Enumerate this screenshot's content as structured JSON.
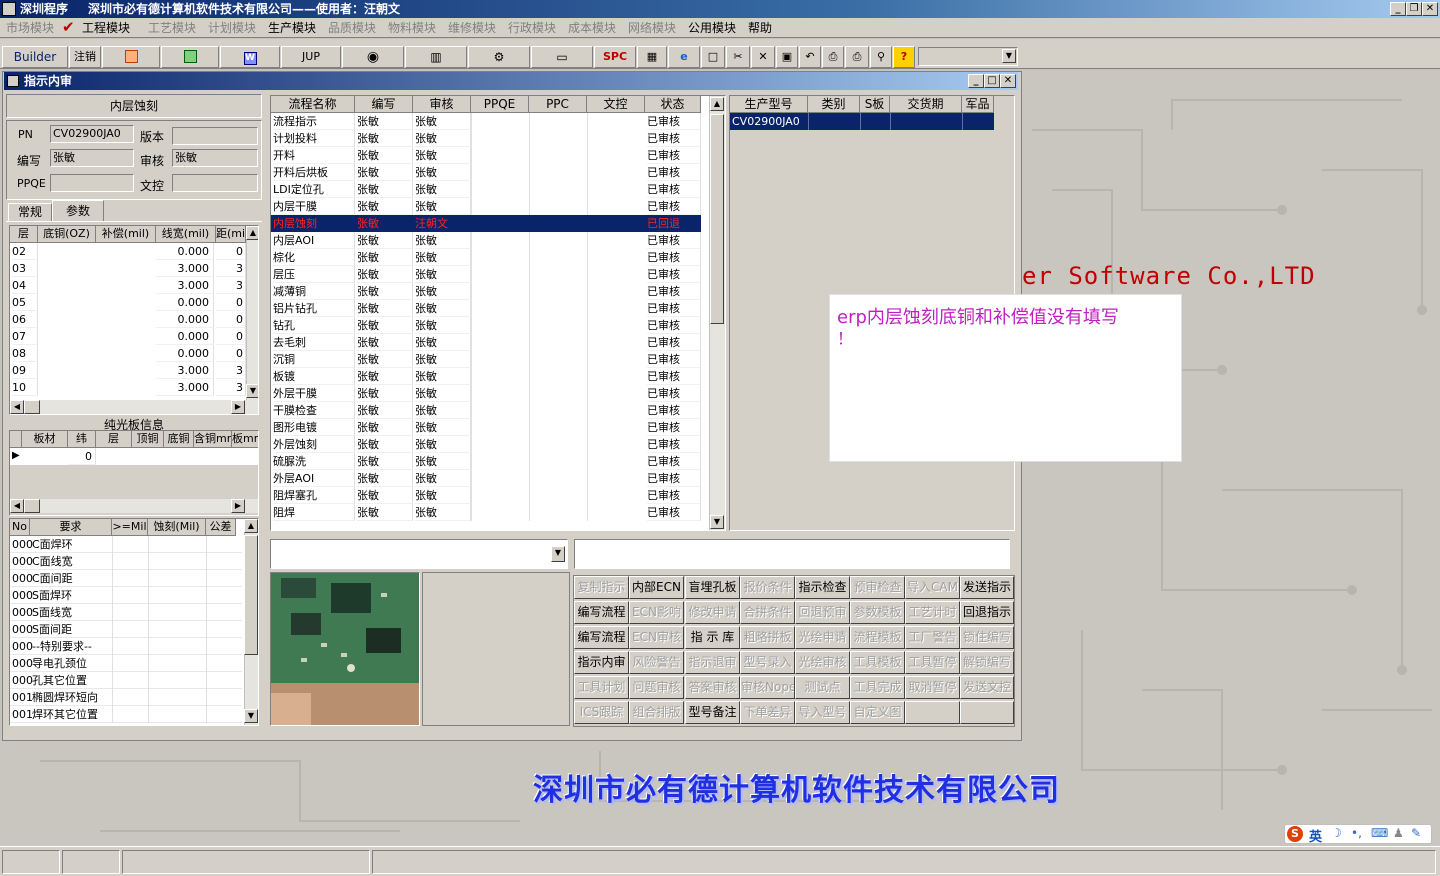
{
  "titlebar": {
    "app": "深圳程序",
    "company_user": "深圳市必有德计算机软件技术有限公司——使用者：汪朝文"
  },
  "menu": [
    {
      "label": "市场模块",
      "enabled": false
    },
    {
      "label": "工程模块",
      "enabled": true
    },
    {
      "label": "工艺模块",
      "enabled": false
    },
    {
      "label": "计划模块",
      "enabled": false
    },
    {
      "label": "生产模块",
      "enabled": true
    },
    {
      "label": "品质模块",
      "enabled": false
    },
    {
      "label": "物料模块",
      "enabled": false
    },
    {
      "label": "维修模块",
      "enabled": false
    },
    {
      "label": "行政模块",
      "enabled": false
    },
    {
      "label": "成本模块",
      "enabled": false
    },
    {
      "label": "网络模块",
      "enabled": false
    },
    {
      "label": "公用模块",
      "enabled": true
    },
    {
      "label": "帮助",
      "enabled": true
    }
  ],
  "toolbar": {
    "builder": "Builder",
    "zhuxiao": "注销",
    "jup": "JUP",
    "spc": "SPC"
  },
  "window": {
    "title": "指示内审"
  },
  "left": {
    "process_name": "内层蚀刻",
    "pn_label": "PN",
    "pn_value": "CV02900JA0",
    "version_label": "版本",
    "version_value": "",
    "author_label": "编写",
    "author_value": "张敏",
    "reviewer_label": "审核",
    "reviewer_value": "张敏",
    "ppqe_label": "PPQE",
    "ppqe_value": "",
    "wenkong_label": "文控",
    "wenkong_value": "",
    "tabs": [
      "常规",
      "参数"
    ],
    "layer_headers": [
      "层",
      "底铜(OZ)",
      "补偿(mil)",
      "线宽(mil)",
      "距(mi"
    ],
    "layers": [
      {
        "layer": "02",
        "dt": "",
        "bc": "",
        "xk": "0.000",
        "j": "0"
      },
      {
        "layer": "03",
        "dt": "",
        "bc": "",
        "xk": "3.000",
        "j": "3"
      },
      {
        "layer": "04",
        "dt": "",
        "bc": "",
        "xk": "3.000",
        "j": "3"
      },
      {
        "layer": "05",
        "dt": "",
        "bc": "",
        "xk": "0.000",
        "j": "0"
      },
      {
        "layer": "06",
        "dt": "",
        "bc": "",
        "xk": "0.000",
        "j": "0"
      },
      {
        "layer": "07",
        "dt": "",
        "bc": "",
        "xk": "0.000",
        "j": "0"
      },
      {
        "layer": "08",
        "dt": "",
        "bc": "",
        "xk": "0.000",
        "j": "0"
      },
      {
        "layer": "09",
        "dt": "",
        "bc": "",
        "xk": "3.000",
        "j": "3"
      },
      {
        "layer": "10",
        "dt": "",
        "bc": "",
        "xk": "3.000",
        "j": "3"
      }
    ],
    "bare_board_title": "纯光板信息",
    "bare_headers": [
      "板材",
      "纬",
      "层",
      "顶铜",
      "底铜",
      "含铜mm",
      "板mm"
    ],
    "bare_row": {
      "wei": "0"
    },
    "req_headers": [
      "No",
      "要求",
      ">=Mil",
      "蚀刻(Mil)",
      "公差"
    ],
    "requirements": [
      {
        "no": "000",
        "req": "C面焊环"
      },
      {
        "no": "000",
        "req": "C面线宽"
      },
      {
        "no": "000",
        "req": "C面间距"
      },
      {
        "no": "000",
        "req": "S面焊环"
      },
      {
        "no": "000",
        "req": "S面线宽"
      },
      {
        "no": "000",
        "req": "S面间距"
      },
      {
        "no": "000",
        "req": "--特别要求--"
      },
      {
        "no": "000",
        "req": "导电孔颈位"
      },
      {
        "no": "000",
        "req": "孔其它位置"
      },
      {
        "no": "001",
        "req": "椭圆焊环短向"
      },
      {
        "no": "001",
        "req": "焊环其它位置"
      }
    ]
  },
  "flow": {
    "headers": [
      "流程名称",
      "编写",
      "审核",
      "PPQE",
      "PPC",
      "文控",
      "状态"
    ],
    "rows": [
      {
        "name": "流程指示",
        "author": "张敏",
        "reviewer": "张敏",
        "status": "已审核"
      },
      {
        "name": "计划投料",
        "author": "张敏",
        "reviewer": "张敏",
        "status": "已审核"
      },
      {
        "name": "开料",
        "author": "张敏",
        "reviewer": "张敏",
        "status": "已审核"
      },
      {
        "name": "开料后烘板",
        "author": "张敏",
        "reviewer": "张敏",
        "status": "已审核"
      },
      {
        "name": "LDI定位孔",
        "author": "张敏",
        "reviewer": "张敏",
        "status": "已审核"
      },
      {
        "name": "内层干膜",
        "author": "张敏",
        "reviewer": "张敏",
        "status": "已审核"
      },
      {
        "name": "内层蚀刻",
        "author": "张敏",
        "reviewer": "汪朝文",
        "status": "已回退"
      },
      {
        "name": "内层AOI",
        "author": "张敏",
        "reviewer": "张敏",
        "status": "已审核"
      },
      {
        "name": "棕化",
        "author": "张敏",
        "reviewer": "张敏",
        "status": "已审核"
      },
      {
        "name": "层压",
        "author": "张敏",
        "reviewer": "张敏",
        "status": "已审核"
      },
      {
        "name": "减薄铜",
        "author": "张敏",
        "reviewer": "张敏",
        "status": "已审核"
      },
      {
        "name": "铝片钻孔",
        "author": "张敏",
        "reviewer": "张敏",
        "status": "已审核"
      },
      {
        "name": "钻孔",
        "author": "张敏",
        "reviewer": "张敏",
        "status": "已审核"
      },
      {
        "name": "去毛刺",
        "author": "张敏",
        "reviewer": "张敏",
        "status": "已审核"
      },
      {
        "name": "沉铜",
        "author": "张敏",
        "reviewer": "张敏",
        "status": "已审核"
      },
      {
        "name": "板镀",
        "author": "张敏",
        "reviewer": "张敏",
        "status": "已审核"
      },
      {
        "name": "外层干膜",
        "author": "张敏",
        "reviewer": "张敏",
        "status": "已审核"
      },
      {
        "name": "干膜检查",
        "author": "张敏",
        "reviewer": "张敏",
        "status": "已审核"
      },
      {
        "name": "图形电镀",
        "author": "张敏",
        "reviewer": "张敏",
        "status": "已审核"
      },
      {
        "name": "外层蚀刻",
        "author": "张敏",
        "reviewer": "张敏",
        "status": "已审核"
      },
      {
        "name": "硫脲洗",
        "author": "张敏",
        "reviewer": "张敏",
        "status": "已审核"
      },
      {
        "name": "外层AOI",
        "author": "张敏",
        "reviewer": "张敏",
        "status": "已审核"
      },
      {
        "name": "阻焊塞孔",
        "author": "张敏",
        "reviewer": "张敏",
        "status": "已审核"
      },
      {
        "name": "阻焊",
        "author": "张敏",
        "reviewer": "张敏",
        "status": "已审核"
      }
    ]
  },
  "product": {
    "headers": [
      "生产型号",
      "类别",
      "S板",
      "交货期",
      "军品"
    ],
    "row": {
      "model": "CV02900JA0"
    }
  },
  "buttons": [
    [
      {
        "l": "复制指示",
        "e": false
      },
      {
        "l": "内部ECN",
        "e": true
      },
      {
        "l": "盲埋孔板",
        "e": true
      },
      {
        "l": "报价条件",
        "e": false
      },
      {
        "l": "指示检查",
        "e": true
      },
      {
        "l": "预审检查",
        "e": false
      },
      {
        "l": "导入CAM",
        "e": false
      },
      {
        "l": "发送指示",
        "e": true
      }
    ],
    [
      {
        "l": "编写流程",
        "e": true
      },
      {
        "l": "ECN影响",
        "e": false
      },
      {
        "l": "修改申请",
        "e": false
      },
      {
        "l": "合拼条件",
        "e": false
      },
      {
        "l": "回退预审",
        "e": false
      },
      {
        "l": "参数模板",
        "e": false
      },
      {
        "l": "工艺计时",
        "e": false
      },
      {
        "l": "回退指示",
        "e": true
      }
    ],
    [
      {
        "l": "编写流程",
        "e": true
      },
      {
        "l": "ECN审核",
        "e": false
      },
      {
        "l": "指 示 库",
        "e": true
      },
      {
        "l": "粗略拼板",
        "e": false
      },
      {
        "l": "光绘申请",
        "e": false
      },
      {
        "l": "流程模板",
        "e": false
      },
      {
        "l": "工厂警告",
        "e": false
      },
      {
        "l": "锁住编写",
        "e": false
      }
    ],
    [
      {
        "l": "指示内审",
        "e": true
      },
      {
        "l": "风险警告",
        "e": false
      },
      {
        "l": "指示退审",
        "e": false
      },
      {
        "l": "型号录入",
        "e": false
      },
      {
        "l": "光绘审核",
        "e": false
      },
      {
        "l": "工具模板",
        "e": false
      },
      {
        "l": "工具暂停",
        "e": false
      },
      {
        "l": "解锁编写",
        "e": false
      }
    ],
    [
      {
        "l": "工具计划",
        "e": false
      },
      {
        "l": "问题审核",
        "e": false
      },
      {
        "l": "答案审核",
        "e": false
      },
      {
        "l": "审核Nope",
        "e": false
      },
      {
        "l": "测试点",
        "e": false
      },
      {
        "l": "工具完成",
        "e": false
      },
      {
        "l": "取消暂停",
        "e": false
      },
      {
        "l": "发送文控",
        "e": false
      }
    ],
    [
      {
        "l": "ICS跟踪",
        "e": false
      },
      {
        "l": "组合排版",
        "e": false
      },
      {
        "l": "型号备注",
        "e": true
      },
      {
        "l": "下单差异",
        "e": false
      },
      {
        "l": "导入型号",
        "e": false
      },
      {
        "l": "自定义图",
        "e": false
      },
      {
        "l": "",
        "e": false
      },
      {
        "l": "",
        "e": false
      }
    ]
  ],
  "note": {
    "line1": "erp内层蚀刻底铜和补偿值没有填写",
    "line2": "！"
  },
  "desktop": {
    "english_brand": "er Software Co.,LTD",
    "chinese_brand": "深圳市必有德计算机软件技术有限公司"
  },
  "tray": {
    "ime": "英"
  }
}
